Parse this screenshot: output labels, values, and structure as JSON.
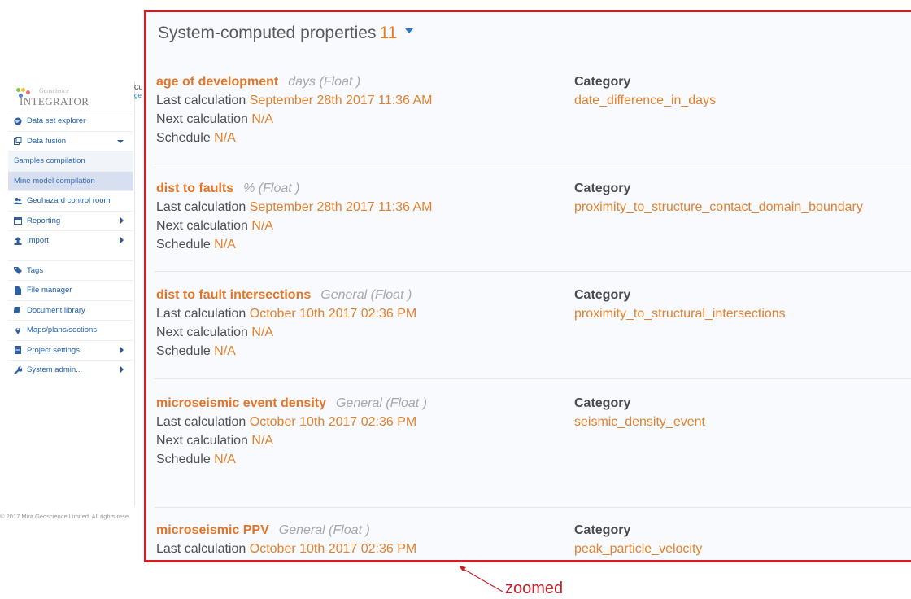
{
  "app": {
    "logo_small": "Geoscience",
    "logo_big": "INTEGRATOR",
    "cu_line1": "Cu",
    "cu_line2": "ge"
  },
  "sidebar": {
    "items": [
      {
        "label": "Data set explorer",
        "icon": "globe-icon",
        "type": "main"
      },
      {
        "label": "Data fusion",
        "icon": "copy-icon",
        "type": "main",
        "expanded": true
      },
      {
        "label": "Samples compilation",
        "type": "sub"
      },
      {
        "label": "Mine model compilation",
        "type": "sub",
        "active": true
      },
      {
        "label": "Geohazard control room",
        "icon": "users-icon",
        "type": "main"
      },
      {
        "label": "Reporting",
        "icon": "calendar-icon",
        "type": "main",
        "submenu": true
      },
      {
        "label": "Import",
        "icon": "upload-icon",
        "type": "main",
        "submenu": true
      },
      {
        "label": "Tags",
        "icon": "tags-icon",
        "type": "main"
      },
      {
        "label": "File manager",
        "icon": "file-icon",
        "type": "main"
      },
      {
        "label": "Document library",
        "icon": "book-icon",
        "type": "main"
      },
      {
        "label": "Maps/plans/sections",
        "icon": "map-marker-icon",
        "type": "main"
      },
      {
        "label": "Project settings",
        "icon": "settings-file-icon",
        "type": "main",
        "submenu": true
      },
      {
        "label": "System admin...",
        "icon": "wrench-icon",
        "type": "main",
        "submenu": true
      }
    ],
    "footer": "© 2017 Mira Geoscience Limited. All rights rese"
  },
  "panel": {
    "title": "System-computed properties",
    "count": "11",
    "labels": {
      "last": "Last calculation",
      "next": "Next calculation",
      "schedule": "Schedule",
      "category": "Category"
    },
    "properties": [
      {
        "name": "age of development",
        "unit": "days (Float )",
        "last": "September 28th 2017 11:36 AM",
        "next": "N/A",
        "schedule": "N/A",
        "category": "date_difference_in_days"
      },
      {
        "name": "dist to faults",
        "unit": "% (Float )",
        "last": "September 28th 2017 11:36 AM",
        "next": "N/A",
        "schedule": "N/A",
        "category": "proximity_to_structure_contact_domain_boundary"
      },
      {
        "name": "dist to fault intersections",
        "unit": "General (Float )",
        "last": "October 10th 2017 02:36 PM",
        "next": "N/A",
        "schedule": "N/A",
        "category": "proximity_to_structural_intersections"
      },
      {
        "name": "microseismic event density",
        "unit": "General (Float )",
        "last": "October 10th 2017 02:36 PM",
        "next": "N/A",
        "schedule": "N/A",
        "category": "seismic_density_event"
      },
      {
        "name": "microseismic PPV",
        "unit": "General (Float )",
        "last": "October 10th 2017 02:36 PM",
        "category": "peak_particle_velocity"
      }
    ]
  },
  "annotation": "zoomed",
  "colors": {
    "accent": "#e1762a",
    "border": "#d21f26",
    "link": "#1e5fa8"
  }
}
